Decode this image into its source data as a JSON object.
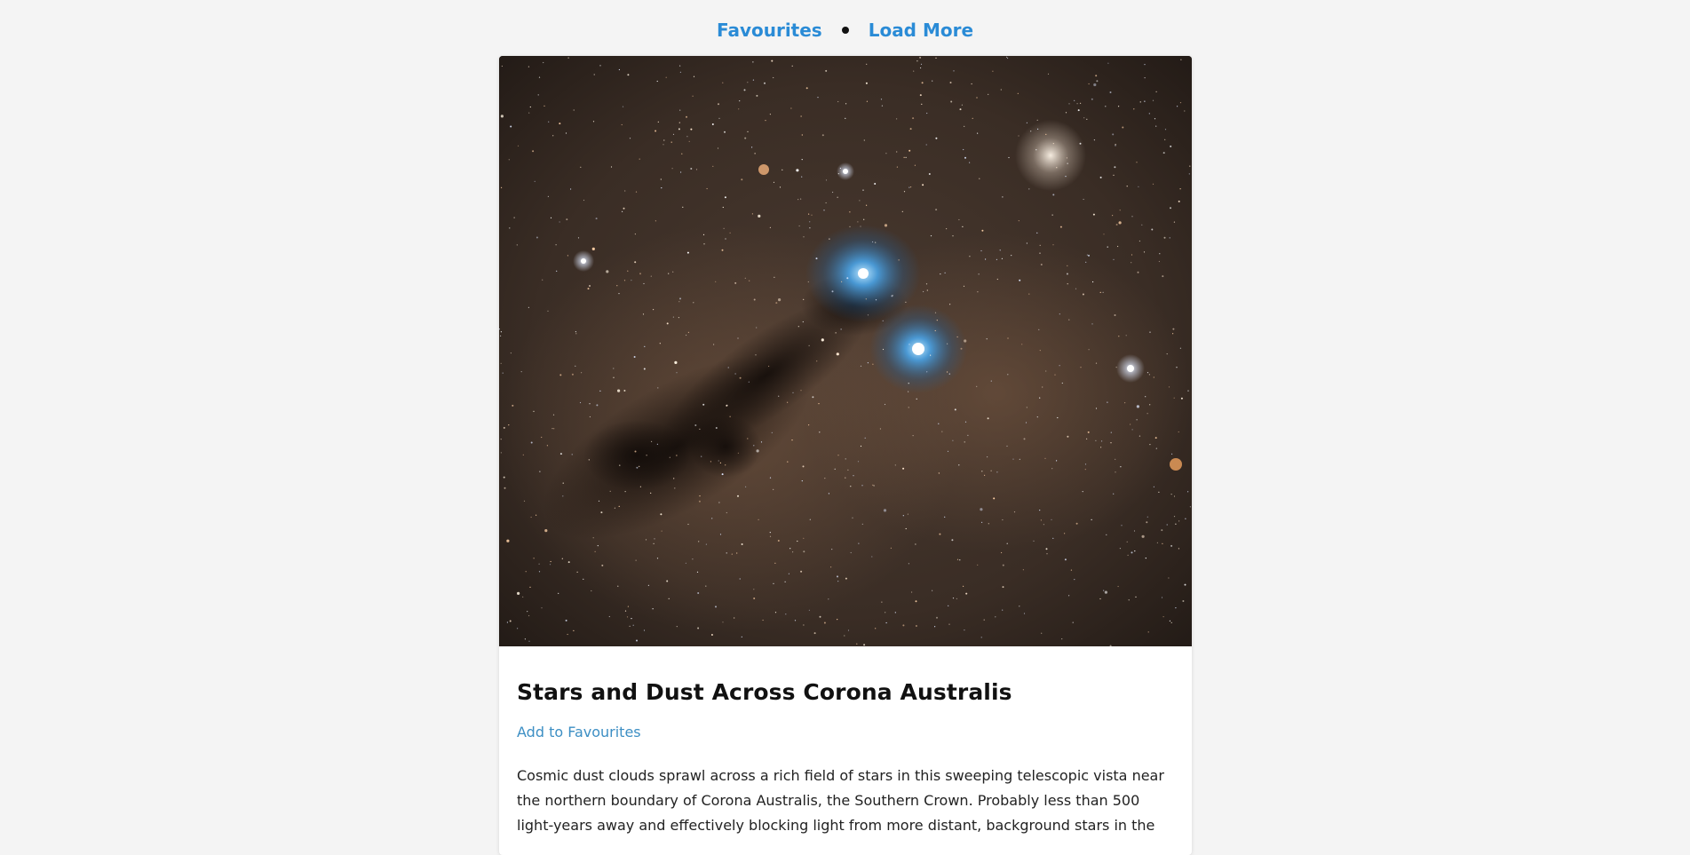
{
  "nav": {
    "favourites_label": "Favourites",
    "load_more_label": "Load More"
  },
  "post": {
    "image_icon": "nebula-photo",
    "title": "Stars and Dust Across Corona Australis",
    "favourite_label": "Add to Favourites",
    "explanation": "Cosmic dust clouds sprawl across a rich field of stars in this sweeping telescopic vista near the northern boundary of Corona Australis, the Southern Crown. Probably less than 500 light-years away and effectively blocking light from more distant, background stars in the"
  },
  "colors": {
    "page_background": "#f4f4f4",
    "link_blue": "#2a8bd6",
    "favourite_link": "#3d8fc4",
    "card_background": "#ffffff"
  }
}
